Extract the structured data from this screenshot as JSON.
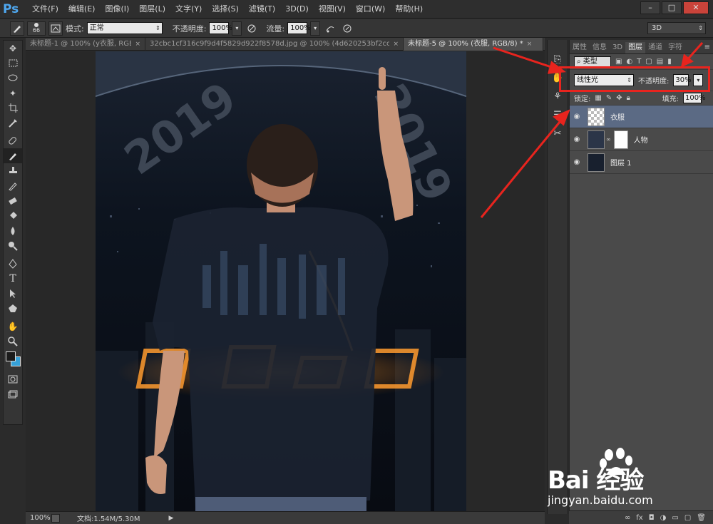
{
  "app": {
    "logo": "Ps"
  },
  "menu": {
    "items": [
      "文件(F)",
      "编辑(E)",
      "图像(I)",
      "图层(L)",
      "文字(Y)",
      "选择(S)",
      "滤镜(T)",
      "3D(D)",
      "视图(V)",
      "窗口(W)",
      "帮助(H)"
    ]
  },
  "window_controls": {
    "minimize": "–",
    "maximize": "□",
    "close": "✕"
  },
  "options": {
    "brush_size": "66",
    "mode_label": "模式:",
    "mode_value": "正常",
    "opacity_label": "不透明度:",
    "opacity_value": "100%",
    "flow_label": "流量:",
    "flow_value": "100%",
    "workspace": "3D"
  },
  "tabs": [
    {
      "label": "未标题-1 @ 100% (y衣服, RGB/...",
      "active": false
    },
    {
      "label": "32cbc1cf316c9f9d4f5829d922f8578d.jpg @ 100% (4d620253bf2cc948cf5...",
      "active": false
    },
    {
      "label": "未标题-5 @ 100% (衣服, RGB/8) *",
      "active": true
    }
  ],
  "tab_close": "×",
  "status": {
    "zoom": "100%",
    "doc": "文档:1.54M/5.30M"
  },
  "artwork": {
    "text_left": "2019",
    "text_right": "2019"
  },
  "panel": {
    "tabs": [
      "属性",
      "信息",
      "3D",
      "图层",
      "通道",
      "字符"
    ],
    "active_tab": "图层",
    "kind": "类型",
    "blend_mode": "线性光",
    "opacity_label": "不透明度:",
    "opacity_value": "30%",
    "lock_label": "锁定:",
    "fill_label": "填充:",
    "fill_value": "100%",
    "layers": [
      {
        "name": "衣服",
        "selected": true
      },
      {
        "name": "人物",
        "selected": false
      },
      {
        "name": "图层 1",
        "selected": false
      }
    ],
    "bottom_icons": [
      "link-icon",
      "fx-icon",
      "mask-icon",
      "adjustment-icon",
      "folder-icon",
      "new-layer-icon",
      "trash-icon"
    ],
    "bottom_glyphs": [
      "∞",
      "fx",
      "◘",
      "◑",
      "▭",
      "▢",
      "🗑"
    ]
  },
  "watermark": {
    "brand": "Bai 经验",
    "url": "jingyan.baidu.com"
  },
  "colors": {
    "accent": "#36a1d8",
    "annotation": "#e8241e",
    "selected_layer": "#5b6a84"
  }
}
